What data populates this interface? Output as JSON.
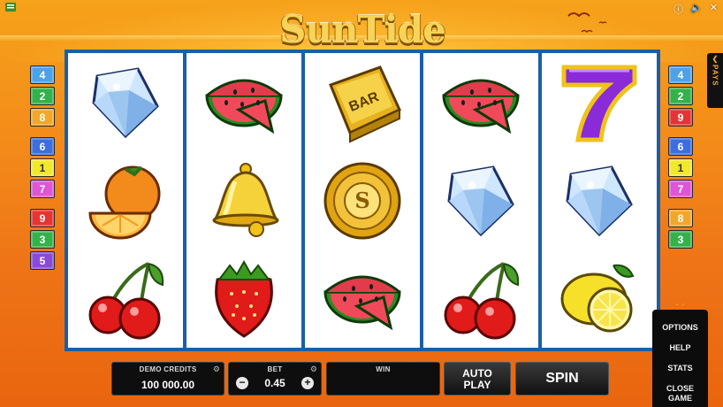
{
  "game": {
    "logo_text": "SunTide"
  },
  "top_bar": {
    "icons": [
      "info-icon",
      "sound-icon",
      "close-icon"
    ]
  },
  "reels": [
    [
      "diamond",
      "orange",
      "cherries"
    ],
    [
      "watermelon",
      "bell",
      "strawberry"
    ],
    [
      "bar",
      "gold-coin",
      "watermelon"
    ],
    [
      "watermelon",
      "diamond",
      "cherries"
    ],
    [
      "seven",
      "diamond",
      "lemon"
    ]
  ],
  "symbol_labels": {
    "bar": "BAR"
  },
  "paylines_left": [
    {
      "num": "4",
      "color": "#4aa3e8"
    },
    {
      "num": "2",
      "color": "#34b24a"
    },
    {
      "num": "8",
      "color": "#f2a72b"
    },
    {
      "num": "6",
      "color": "#3c6ee0"
    },
    {
      "num": "1",
      "color": "#f2e82b"
    },
    {
      "num": "7",
      "color": "#e055d8"
    },
    {
      "num": "9",
      "color": "#e53434"
    },
    {
      "num": "3",
      "color": "#34b24a"
    },
    {
      "num": "5",
      "color": "#8a4ad8"
    }
  ],
  "paylines_right": [
    {
      "num": "4",
      "color": "#4aa3e8"
    },
    {
      "num": "2",
      "color": "#34b24a"
    },
    {
      "num": "9",
      "color": "#e53434"
    },
    {
      "num": "6",
      "color": "#3c6ee0"
    },
    {
      "num": "1",
      "color": "#f2e82b"
    },
    {
      "num": "7",
      "color": "#e055d8"
    },
    {
      "num": "8",
      "color": "#f2a72b"
    },
    {
      "num": "3",
      "color": "#34b24a"
    }
  ],
  "pays_tab": {
    "label": "PAYS"
  },
  "bottom": {
    "credits_caption": "DEMO CREDITS",
    "credits_value": "100 000.00",
    "bet_caption": "BET",
    "bet_value": "0.45",
    "bet_minus": "−",
    "bet_plus": "+",
    "win_caption": "WIN",
    "win_value": "",
    "autoplay_label_1": "AUTO",
    "autoplay_label_2": "PLAY",
    "spin_label": "SPIN"
  },
  "side_menu": {
    "items": [
      "OPTIONS",
      "HELP",
      "STATS",
      "CLOSE GAME"
    ]
  },
  "colors": {
    "reel_frame": "#1a5fa8",
    "background_top": "#f6a21a",
    "background_bottom": "#e9650f"
  }
}
